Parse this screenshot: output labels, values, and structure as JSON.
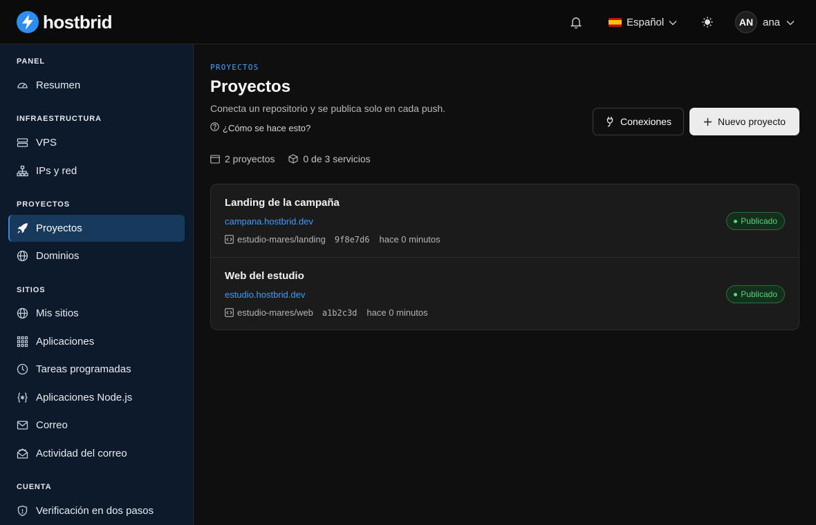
{
  "app": {
    "brand": "hostbrid"
  },
  "header": {
    "notifications_icon": "bell-icon",
    "language": "Español",
    "theme_icon": "sun-icon",
    "user_initials": "AN",
    "user_name": "ana"
  },
  "sidebar": {
    "sections": [
      {
        "title": "PANEL",
        "items": [
          {
            "label": "Resumen",
            "icon": "gauge-icon"
          }
        ]
      },
      {
        "title": "INFRAESTRUCTURA",
        "items": [
          {
            "label": "VPS",
            "icon": "server-icon"
          },
          {
            "label": "IPs y red",
            "icon": "network-icon"
          }
        ]
      },
      {
        "title": "PROYECTOS",
        "items": [
          {
            "label": "Proyectos",
            "icon": "rocket-icon",
            "active": true
          },
          {
            "label": "Dominios",
            "icon": "globe-icon"
          }
        ]
      },
      {
        "title": "SITIOS",
        "items": [
          {
            "label": "Mis sitios",
            "icon": "globe-icon"
          },
          {
            "label": "Aplicaciones",
            "icon": "grid-icon"
          },
          {
            "label": "Tareas programadas",
            "icon": "clock-icon"
          },
          {
            "label": "Aplicaciones Node.js",
            "icon": "braces-icon"
          },
          {
            "label": "Correo",
            "icon": "mail-icon"
          },
          {
            "label": "Actividad del correo",
            "icon": "mail-open-icon"
          }
        ]
      },
      {
        "title": "CUENTA",
        "items": [
          {
            "label": "Verificación en dos pasos",
            "icon": "shield-icon"
          }
        ]
      }
    ]
  },
  "main": {
    "breadcrumb": "PROYECTOS",
    "title": "Proyectos",
    "subtitle": "Conecta un repositorio y se publica solo en cada push.",
    "help_link": "¿Cómo se hace esto?",
    "buttons": {
      "connections": "Conexiones",
      "new_project": "Nuevo proyecto"
    },
    "stats": {
      "projects": "2 proyectos",
      "services": "0 de 3 servicios"
    },
    "projects": [
      {
        "name": "Landing de la campaña",
        "url": "campana.hostbrid.dev",
        "repo": "estudio-mares/landing",
        "commit": "9f8e7d6",
        "updated": "hace 0 minutos",
        "status": "Publicado"
      },
      {
        "name": "Web del estudio",
        "url": "estudio.hostbrid.dev",
        "repo": "estudio-mares/web",
        "commit": "a1b2c3d",
        "updated": "hace 0 minutos",
        "status": "Publicado"
      }
    ]
  },
  "colors": {
    "accent": "#3d9bff",
    "sidebar_bg": "#0c1a2b",
    "active_item": "#173a5c",
    "status_green": "#4ade80"
  }
}
